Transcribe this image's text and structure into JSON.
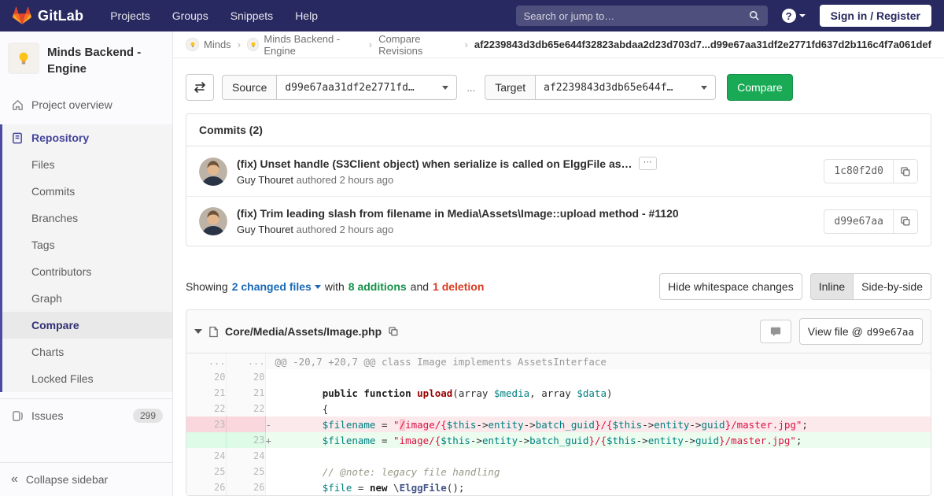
{
  "header": {
    "logo_text": "GitLab",
    "nav": [
      "Projects",
      "Groups",
      "Snippets",
      "Help"
    ],
    "search_placeholder": "Search or jump to…",
    "help_glyph": "?",
    "sign_in": "Sign in / Register"
  },
  "sidebar": {
    "project_name": "Minds Backend - Engine",
    "overview_label": "Project overview",
    "section_label": "Repository",
    "repo_items": [
      "Files",
      "Commits",
      "Branches",
      "Tags",
      "Contributors",
      "Graph",
      "Compare",
      "Charts",
      "Locked Files"
    ],
    "active_item": "Compare",
    "issues_label": "Issues",
    "issues_count": "299",
    "collapse_label": "Collapse sidebar",
    "collapse_glyph": "«"
  },
  "breadcrumb": {
    "items": [
      "Minds",
      "Minds Backend - Engine",
      "Compare Revisions"
    ],
    "separator": "›",
    "current": "af2239843d3db65e644f32823abdaa2d23d703d7...d99e67aa31df2e2771fd637d2b116c4f7a061def"
  },
  "compare_form": {
    "source_label": "Source",
    "source_value": "d99e67aa31df2e2771fd…",
    "separator": "...",
    "target_label": "Target",
    "target_value": "af2239843d3db65e644f…",
    "compare_button": "Compare"
  },
  "commits": {
    "title": "Commits (2)",
    "expand_glyph": "⋯",
    "items": [
      {
        "title": "(fix) Unset handle (S3Client object) when serialize is called on ElggFile as…",
        "author": "Guy Thouret",
        "meta": "authored 2 hours ago",
        "sha": "1c80f2d0"
      },
      {
        "title": "(fix) Trim leading slash from filename in Media\\Assets\\Image::upload method - #1120",
        "author": "Guy Thouret",
        "meta": "authored 2 hours ago",
        "sha": "d99e67aa"
      }
    ]
  },
  "summary": {
    "showing": "Showing",
    "changed_files": "2 changed files",
    "with_text": "with",
    "additions": "8 additions",
    "and_text": "and",
    "deletions": "1 deletion",
    "hide_whitespace": "Hide whitespace changes",
    "inline": "Inline",
    "side_by_side": "Side-by-side"
  },
  "diff": {
    "file_path": "Core/Media/Assets/Image.php",
    "view_file_label": "View file @",
    "view_file_sha": "d99e67aa",
    "rows": [
      {
        "old": "...",
        "new": "...",
        "marker": "",
        "segs": [
          "@@ -20,7 +20,7 @@ class Image implements AssetsInterface"
        ]
      },
      {
        "old": "20",
        "new": "20",
        "marker": " ",
        "segs": []
      },
      {
        "old": "21",
        "new": "21",
        "marker": " ",
        "segs": [
          "        ",
          "public function ",
          "upload",
          "(array ",
          "$media",
          ", array ",
          "$data",
          ")"
        ]
      },
      {
        "old": "22",
        "new": "22",
        "marker": " ",
        "segs": [
          "        {"
        ]
      },
      {
        "old": "23",
        "new": "",
        "marker": "-",
        "segs": [
          "        ",
          "$filename",
          " = ",
          "\"",
          "/",
          "image/{",
          "$this",
          "->",
          "entity",
          "->",
          "batch_guid",
          "}/{",
          "$this",
          "->",
          "entity",
          "->",
          "guid",
          "}/master.jpg\"",
          ";"
        ]
      },
      {
        "old": "",
        "new": "23",
        "marker": "+",
        "segs": [
          "        ",
          "$filename",
          " = ",
          "\"image/{",
          "$this",
          "->",
          "entity",
          "->",
          "batch_guid",
          "}/{",
          "$this",
          "->",
          "entity",
          "->",
          "guid",
          "}/master.jpg\"",
          ";"
        ]
      },
      {
        "old": "24",
        "new": "24",
        "marker": " ",
        "segs": []
      },
      {
        "old": "25",
        "new": "25",
        "marker": " ",
        "segs": [
          "        ",
          "// @note: legacy file handling"
        ]
      },
      {
        "old": "26",
        "new": "26",
        "marker": " ",
        "segs": [
          "        ",
          "$file",
          " = ",
          "new",
          " \\",
          "ElggFile",
          "();"
        ]
      }
    ]
  },
  "colors": {
    "navbar_bg": "#292961",
    "accent_green": "#1aaa55",
    "link_blue": "#1b69b6",
    "addition_green": "#168f48",
    "deletion_red": "#db3b21",
    "active_border": "#4b4ba3",
    "del_line_bg": "#fbe9eb",
    "add_line_bg": "#ecfdf0"
  }
}
